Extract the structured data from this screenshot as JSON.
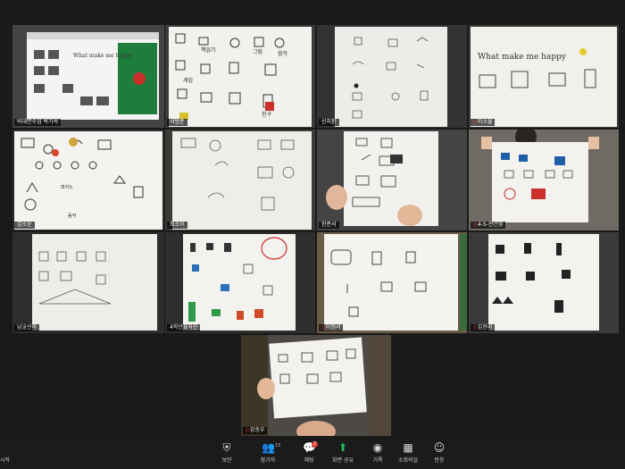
{
  "participants": [
    {
      "name": "비대면수업 박기석",
      "muted": false
    },
    {
      "name": "서범준",
      "muted": false
    },
    {
      "name": "신지환",
      "muted": false
    },
    {
      "name": "이소율",
      "muted": true
    },
    {
      "name": "김소윤",
      "muted": false
    },
    {
      "name": "최소아",
      "muted": false
    },
    {
      "name": "한준서",
      "muted": false
    },
    {
      "name": "4-5-전건영",
      "muted": true
    },
    {
      "name": "남궁선아",
      "muted": false
    },
    {
      "name": "4학년표하진",
      "muted": false
    },
    {
      "name": "이현서",
      "muted": true
    },
    {
      "name": "김현서",
      "muted": true
    },
    {
      "name": "강승우",
      "muted": true
    }
  ],
  "drawings": {
    "slide_text": "What make me happy",
    "drawing_4_title": "What make me happy",
    "korean_words": [
      "책읽기",
      "그림",
      "음악",
      "게임",
      "피아노",
      "친구"
    ],
    "colors": {
      "active_border": "#e8e32a",
      "share_green": "#21c05a",
      "mute_red": "#e3362c"
    }
  },
  "toolbar": {
    "left_label": "시작",
    "items": [
      {
        "label": "보안",
        "icon": "shield-icon"
      },
      {
        "label": "참가자",
        "icon": "participants-icon",
        "count": "15"
      },
      {
        "label": "채팅",
        "icon": "chat-icon",
        "badge": "2"
      },
      {
        "label": "화면 공유",
        "icon": "share-screen-icon"
      },
      {
        "label": "기록",
        "icon": "record-icon"
      },
      {
        "label": "소회의실",
        "icon": "breakout-rooms-icon"
      },
      {
        "label": "반응",
        "icon": "reactions-icon"
      }
    ]
  }
}
